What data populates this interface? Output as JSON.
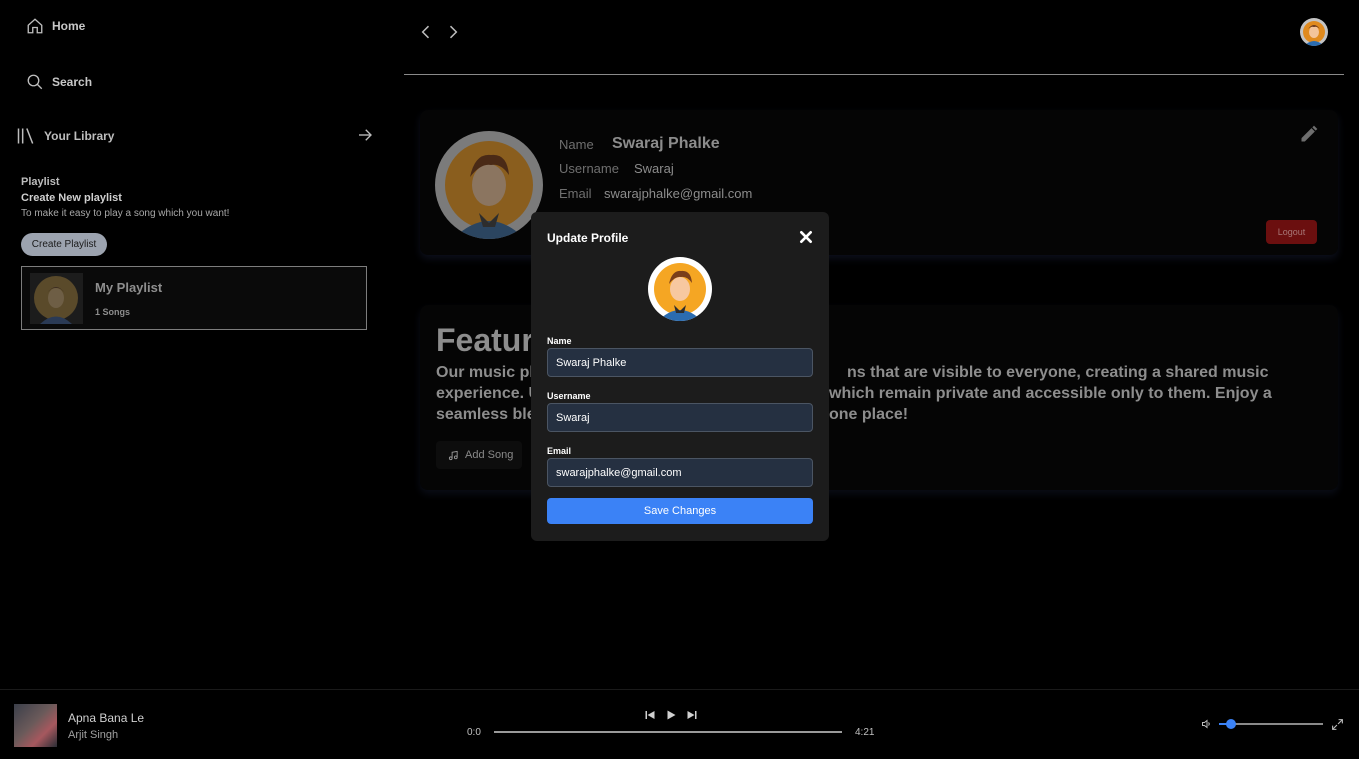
{
  "sidebar": {
    "home_label": "Home",
    "search_label": "Search",
    "library_label": "Your Library",
    "playlist_heading": "Playlist",
    "create_new_title": "Create New playlist",
    "create_new_desc": "To make it easy to play a song which you want!",
    "create_button": "Create Playlist",
    "playlists": [
      {
        "name": "My Playlist",
        "count": "1 Songs"
      }
    ]
  },
  "profile": {
    "name_label": "Name",
    "name_value": "Swaraj Phalke",
    "username_label": "Username",
    "username_value": "Swaraj",
    "email_label": "Email",
    "email_value": "swarajphalke@gmail.com",
    "logout_label": "Logout"
  },
  "featured": {
    "title": "Featur",
    "desc_line1_a": "Our music pl",
    "desc_line1_b": "ns that are visible to everyone, creating a shared music",
    "desc_line2_a": "experience. U",
    "desc_line2_b": "which remain private and accessible only to them. Enjoy a",
    "desc_line3_a": "seamless ble",
    "desc_line3_b": "one place!",
    "add_song_label": "Add Song"
  },
  "modal": {
    "title": "Update Profile",
    "name_label": "Name",
    "name_value": "Swaraj Phalke",
    "username_label": "Username",
    "username_value": "Swaraj",
    "email_label": "Email",
    "email_value": "swarajphalke@gmail.com",
    "save_label": "Save Changes"
  },
  "player": {
    "title": "Apna Bana Le",
    "artist": "Arjit Singh",
    "current_time": "0:0",
    "total_time": "4:21",
    "volume_fraction": 0.12
  },
  "colors": {
    "accent": "#3b82f6",
    "logout": "#6b0f0f",
    "modal_bg": "#1c1c1c",
    "input_bg": "#253041"
  }
}
